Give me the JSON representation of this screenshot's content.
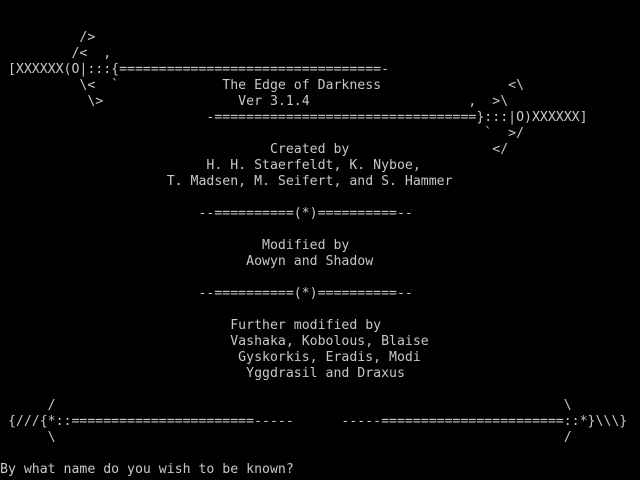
{
  "terminal": {
    "text_color": "#c8c8c8",
    "background": "#000000",
    "lines": [
      "          />",
      "         /<  ,",
      " [XXXXXX(O|:::{=================================-",
      "          \\<  `             The Edge of Darkness                <\\",
      "           \\>                 Ver 3.1.4                    ,  >\\",
      "                          -=================================}:::|O)XXXXXX]",
      "                                                             `  >/",
      "                                  Created by                  </",
      "                          H. H. Staerfeldt, K. Nyboe,",
      "                     T. Madsen, M. Seifert, and S. Hammer",
      "",
      "                         --==========(*)==========--",
      "",
      "                                 Modified by",
      "                               Aowyn and Shadow",
      "",
      "                         --==========(*)==========--",
      "",
      "                             Further modified by",
      "                             Vashaka, Kobolous, Blaise",
      "                              Gyskorkis, Eradis, Modi",
      "                               Yggdrasil and Draxus",
      "",
      "      /                                                                \\",
      " {///{*::=======================-----      -----=======================::*}\\\\\\}",
      "      \\                                                                /"
    ],
    "prompt": "By what name do you wish to be known? ",
    "input_value": ""
  }
}
